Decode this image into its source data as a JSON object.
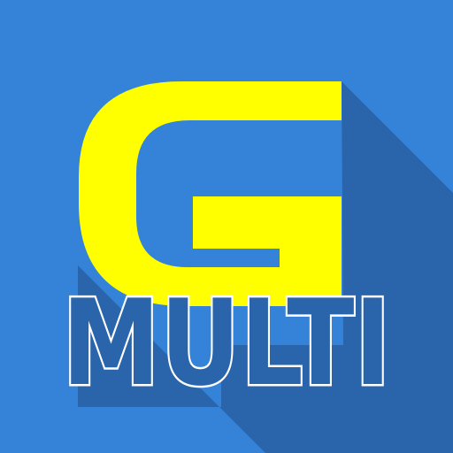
{
  "icon": {
    "letter": "G",
    "label": "MULTI",
    "name": "multi-app-icon"
  },
  "colors": {
    "background": "#3483D9",
    "long_shadow": "#2A65AB",
    "letter_fill": "#FFFF00",
    "label_fill": "#2A65AB",
    "label_outline": "#FFFFFF"
  }
}
